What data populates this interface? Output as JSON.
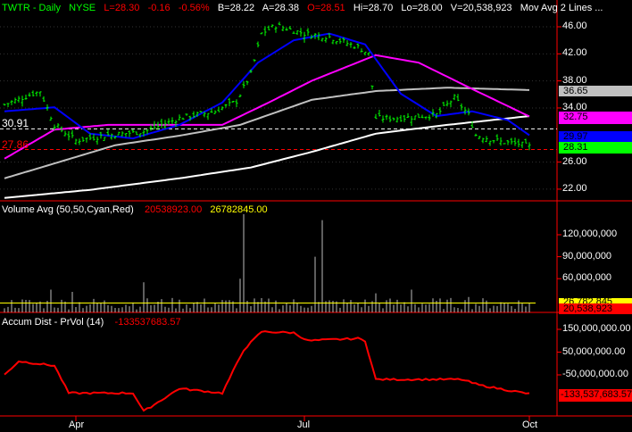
{
  "header": {
    "symbol": "TWTR - Daily",
    "exchange": "NYSE",
    "last": "L=28.30",
    "change": "-0.16",
    "pct": "-0.56%",
    "bid": "B=28.22",
    "ask": "A=28.38",
    "open": "O=28.51",
    "hi": "Hi=28.70",
    "lo": "Lo=28.00",
    "vol": "V=20,538,923",
    "study": "Mov Avg 2 Lines ..."
  },
  "colors": {
    "up": "#00ff00",
    "down": "#ff0000",
    "ma_blue": "#0000ff",
    "ma_magenta": "#ff00ff",
    "ma_grey": "#c0c0c0",
    "ma_white": "#ffffff",
    "axis": "#ff0000"
  },
  "price_panel": {
    "line_labels": {
      "white_dashed": "30.91",
      "red_dashed": "27.86"
    },
    "tags": {
      "grey": "36.65",
      "magenta": "32.75",
      "blue": "29.97",
      "green": "28.31"
    }
  },
  "volume_panel": {
    "title": "Volume Avg (50,50,Cyan,Red)",
    "value": "20538923.00",
    "avg": "26782845.00",
    "tag_avg": "26,782,845",
    "tag_vol": "20,538,923"
  },
  "accum_panel": {
    "title": "Accum Dist - PrVol (14)",
    "value": "-133537683.57",
    "tag": "-133,537,683.57"
  },
  "chart_data": [
    {
      "type": "line",
      "title": "TWTR - Daily",
      "bars": 148,
      "ylim": [
        20,
        48
      ],
      "yticks": [
        "46.00",
        "42.00",
        "38.00",
        "34.00",
        "26.00",
        "22.00"
      ],
      "ytick_values": [
        46,
        42,
        38,
        34,
        26,
        22
      ],
      "close_keypoints": [
        [
          0,
          34.5
        ],
        [
          10,
          36.5
        ],
        [
          14,
          31.5
        ],
        [
          20,
          29.2
        ],
        [
          29,
          30
        ],
        [
          39,
          30.5
        ],
        [
          49,
          32.5
        ],
        [
          59,
          33.5
        ],
        [
          65,
          35
        ],
        [
          69,
          39
        ],
        [
          72,
          45
        ],
        [
          76,
          46.2
        ],
        [
          84,
          45
        ],
        [
          91,
          44.5
        ],
        [
          99,
          43
        ],
        [
          102,
          42
        ],
        [
          104,
          32.5
        ],
        [
          111,
          32.5
        ],
        [
          121,
          33
        ],
        [
          126,
          35.5
        ],
        [
          130,
          33
        ],
        [
          132,
          30
        ],
        [
          139,
          29
        ],
        [
          144,
          28.7
        ],
        [
          147,
          28.31
        ]
      ],
      "ma_blue": [
        [
          0,
          33.5
        ],
        [
          14,
          34.1
        ],
        [
          24,
          30.2
        ],
        [
          36,
          29.5
        ],
        [
          49,
          31.5
        ],
        [
          61,
          34.8
        ],
        [
          71,
          40.7
        ],
        [
          81,
          44
        ],
        [
          91,
          45
        ],
        [
          101,
          43.4
        ],
        [
          111,
          36.1
        ],
        [
          121,
          32.8
        ],
        [
          131,
          33.5
        ],
        [
          141,
          32.2
        ],
        [
          147,
          29.97
        ]
      ],
      "ma_magenta": [
        [
          0,
          26.5
        ],
        [
          14,
          30.8
        ],
        [
          29,
          31.5
        ],
        [
          44,
          31.5
        ],
        [
          61,
          31.5
        ],
        [
          74,
          34.8
        ],
        [
          86,
          38
        ],
        [
          104,
          41.8
        ],
        [
          116,
          40.7
        ],
        [
          131,
          36.8
        ],
        [
          147,
          32.75
        ]
      ],
      "ma_grey": [
        [
          0,
          23.6
        ],
        [
          14,
          25.8
        ],
        [
          31,
          28.5
        ],
        [
          49,
          29.9
        ],
        [
          66,
          31.5
        ],
        [
          86,
          35.2
        ],
        [
          104,
          36.5
        ],
        [
          124,
          37
        ],
        [
          147,
          36.65
        ]
      ],
      "ma_white": [
        [
          0,
          20.7
        ],
        [
          24,
          21.9
        ],
        [
          49,
          23.6
        ],
        [
          69,
          25.2
        ],
        [
          86,
          27.5
        ],
        [
          104,
          30.2
        ],
        [
          124,
          31.5
        ],
        [
          147,
          32.8
        ]
      ],
      "hlines": [
        30.91,
        27.86
      ]
    },
    {
      "type": "bar",
      "title": "Volume",
      "yticks": [
        "120,000,000",
        "90,000,000",
        "60,000,000"
      ],
      "ytick_values": [
        120,
        90,
        60
      ],
      "unit": "millions",
      "avg": 26.78,
      "spikes": [
        [
          13,
          45
        ],
        [
          19,
          42
        ],
        [
          39,
          55
        ],
        [
          66,
          60
        ],
        [
          67,
          148
        ],
        [
          87,
          90
        ],
        [
          89,
          140
        ],
        [
          104,
          40
        ],
        [
          114,
          45
        ],
        [
          130,
          35
        ]
      ]
    },
    {
      "type": "line",
      "title": "Accum Dist - PrVol (14)",
      "unit": "millions",
      "yticks": [
        "150,000,000.00",
        "50,000,000.00",
        "-50,000,000.00"
      ],
      "ytick_values": [
        150,
        50,
        -50
      ],
      "keypoints": [
        [
          0,
          -50
        ],
        [
          4,
          10
        ],
        [
          14,
          -10
        ],
        [
          18,
          -130
        ],
        [
          36,
          -130
        ],
        [
          39,
          -210
        ],
        [
          49,
          -110
        ],
        [
          61,
          -130
        ],
        [
          67,
          60
        ],
        [
          72,
          140
        ],
        [
          81,
          135
        ],
        [
          85,
          100
        ],
        [
          99,
          110
        ],
        [
          101,
          100
        ],
        [
          104,
          -70
        ],
        [
          128,
          -70
        ],
        [
          133,
          -95
        ],
        [
          147,
          -133.5
        ]
      ]
    }
  ],
  "xaxis": {
    "labels": [
      "Apr",
      "Jul",
      "Oct"
    ],
    "bar_index": [
      21,
      85,
      148
    ]
  }
}
